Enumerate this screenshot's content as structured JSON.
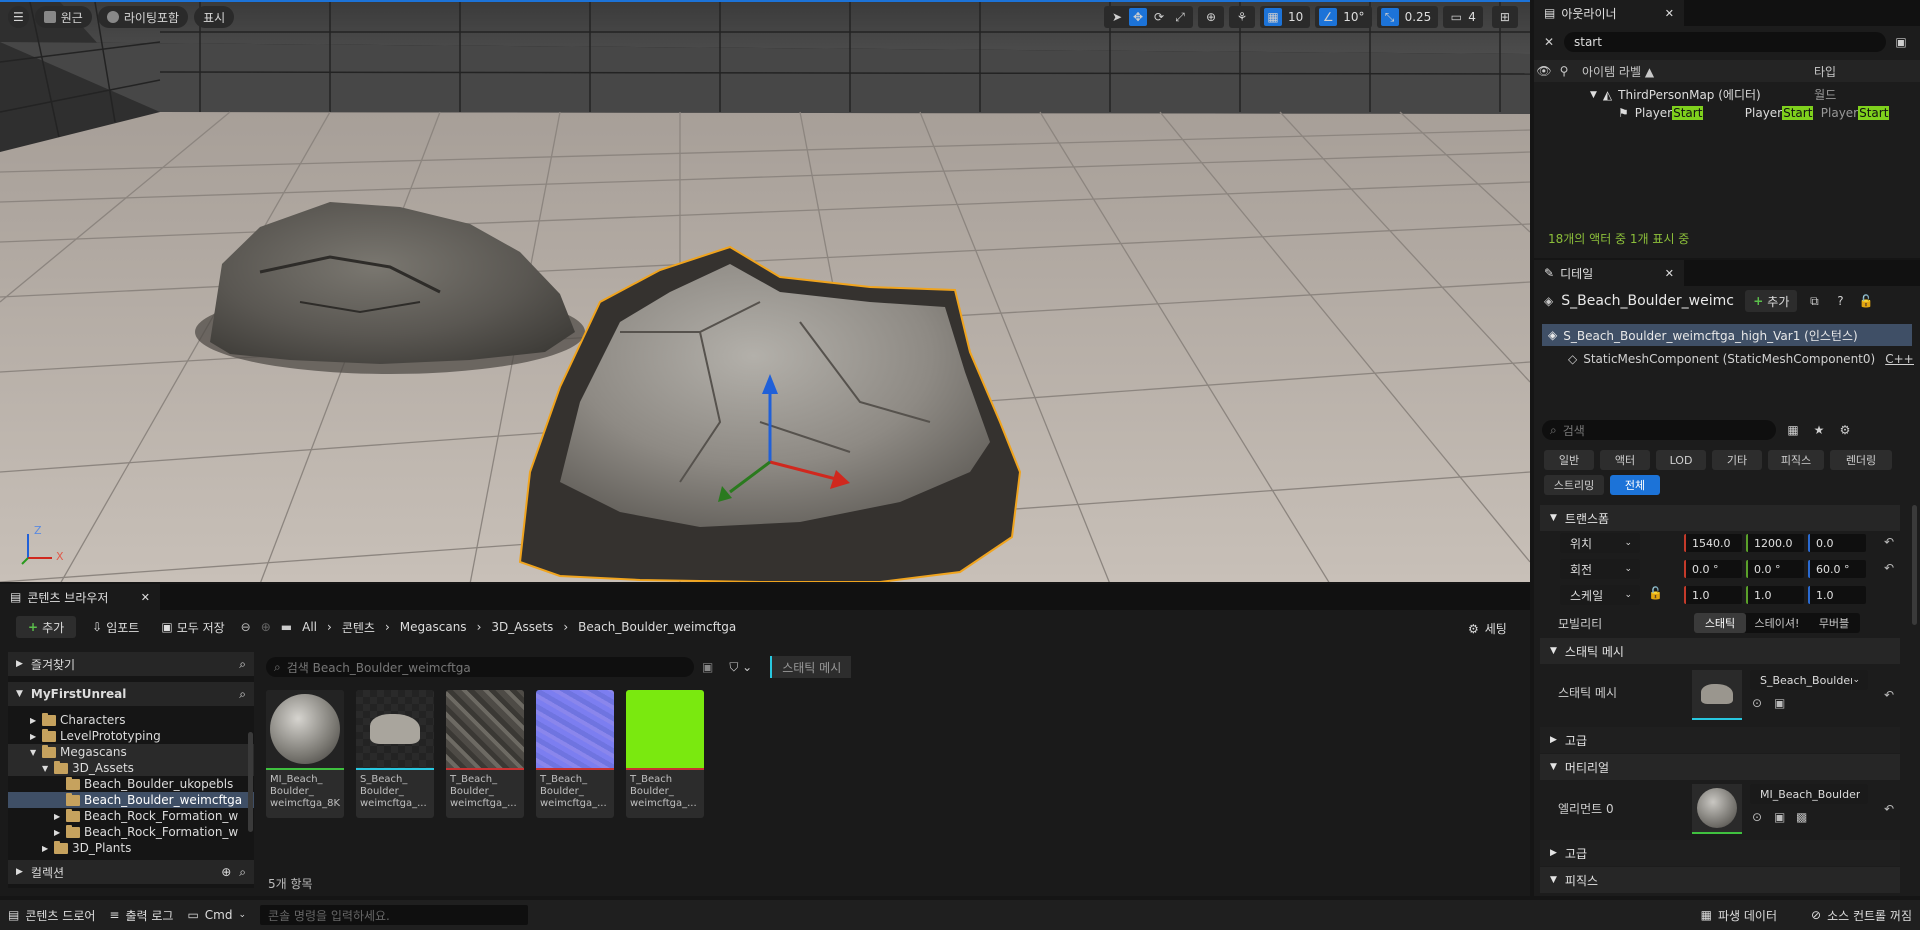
{
  "viewport": {
    "menu_label": "",
    "perspective": "원근",
    "lighting": "라이팅포함",
    "show": "표시",
    "grid_snap": "10",
    "rotation_snap": "10°",
    "scale_snap": "0.25",
    "camera_speed": "4",
    "axis_z": "Z",
    "axis_x": "X"
  },
  "outliner": {
    "tab": "아웃라이너",
    "search_value": "start",
    "col_label": "아이템 라벨 ▲",
    "col_type": "타입",
    "map_name": "ThirdPersonMap (에디터)",
    "map_type": "월드",
    "actor_pre": "Player",
    "actor_hl": "Start",
    "status": "18개의 액터 중 1개 표시 중"
  },
  "details": {
    "tab": "디테일",
    "actor_name": "S_Beach_Boulder_weimc",
    "add_label": "추가",
    "instance": "S_Beach_Boulder_weimcftga_high_Var1 (인스턴스)",
    "component": "StaticMeshComponent (StaticMeshComponent0)",
    "component_suffix": "C++C",
    "search_placeholder": "검색",
    "cats_row1": [
      "일반",
      "액터",
      "LOD",
      "기타",
      "피직스",
      "렌더링"
    ],
    "cats_row2": [
      "스트리밍",
      "전체"
    ],
    "transform": "트랜스폼",
    "location": "위치",
    "rotation": "회전",
    "scale": "스케일",
    "loc": [
      "1540.0",
      "1200.0",
      "0.0"
    ],
    "rot": [
      "0.0 °",
      "0.0 °",
      "60.0 °"
    ],
    "scl": [
      "1.0",
      "1.0",
      "1.0"
    ],
    "mobility": "모빌리티",
    "mob_opts": [
      "스태틱",
      "스테이셔!",
      "무버블"
    ],
    "static_mesh_section": "스태틱 메시",
    "static_mesh_label": "스태틱 메시",
    "static_mesh_value": "S_Beach_Boulder",
    "advanced1": "고급",
    "material_section": "머티리얼",
    "element0": "엘리먼트 0",
    "material_value": "MI_Beach_Boulder_wei",
    "advanced2": "고급",
    "physics": "피직스"
  },
  "content_browser": {
    "tab": "콘텐츠 브라우저",
    "add": "추가",
    "import": "임포트",
    "save_all": "모두 저장",
    "crumbs": [
      "All",
      "콘텐츠",
      "Megascans",
      "3D_Assets",
      "Beach_Boulder_weimcftga"
    ],
    "settings": "세팅",
    "favorites": "즐겨찾기",
    "project": "MyFirstUnreal",
    "tree": [
      "Characters",
      "LevelPrototyping",
      "Megascans",
      "3D_Assets",
      "Beach_Boulder_ukopebls",
      "Beach_Boulder_weimcftga",
      "Beach_Rock_Formation_w",
      "Beach_Rock_Formation_w",
      "3D_Plants"
    ],
    "collections": "컬렉션",
    "search_placeholder": "검색 Beach_Boulder_weimcftga",
    "filter_chip": "스태틱 메시",
    "assets": [
      {
        "name": "MI_Beach_\nBoulder_\nweimcftga_8K",
        "bar": "#3fc03f"
      },
      {
        "name": "S_Beach_\nBoulder_\nweimcftga_...",
        "bar": "#28c8e0"
      },
      {
        "name": "T_Beach_\nBoulder_\nweimcftga_...",
        "bar": "#c83232"
      },
      {
        "name": "T_Beach_\nBoulder_\nweimcftga_...",
        "bar": "#c83232"
      },
      {
        "name": "T_Beach\nBoulder_\nweimcftga_...",
        "bar": "#c83232"
      }
    ],
    "count": "5개 항목"
  },
  "statusbar": {
    "drawer": "콘텐츠 드로어",
    "output": "출력 로그",
    "cmd": "Cmd",
    "cmd_placeholder": "콘솔 명령을 입력하세요.",
    "derived": "파생 데이터",
    "source_control": "소스 컨트롤 꺼짐"
  }
}
